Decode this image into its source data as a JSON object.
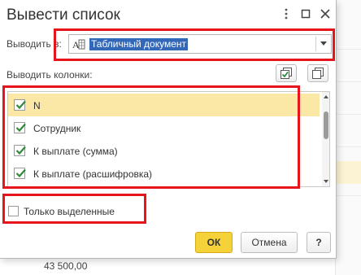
{
  "dialog": {
    "title": "Вывести список",
    "menu_icon": "more-vertical-icon",
    "maximize_icon": "maximize-icon",
    "close_icon": "close-icon"
  },
  "output": {
    "label": "Выводить в:",
    "selected_value": "Табличный документ",
    "icon": "spreadsheet-document-icon"
  },
  "columns": {
    "label": "Выводить колонки:",
    "check_all_icon": "check-all-icon",
    "copy_icon": "copy-icon",
    "items": [
      {
        "label": "N",
        "checked": true,
        "selected": true
      },
      {
        "label": "Сотрудник",
        "checked": true,
        "selected": false
      },
      {
        "label": "К выплате (сумма)",
        "checked": true,
        "selected": false
      },
      {
        "label": "К выплате (расшифровка)",
        "checked": true,
        "selected": false
      }
    ]
  },
  "only_selected": {
    "label": "Только выделенные",
    "checked": false
  },
  "buttons": {
    "ok": "ОК",
    "cancel": "Отмена",
    "help": "?"
  },
  "background": {
    "amount": "43 500,00"
  },
  "colors": {
    "accent_button": "#f5d23a",
    "selection_row": "#fbe8a6",
    "selected_text_bg": "#3367b8",
    "annotation_frame": "#e8141b",
    "checkmark": "#2e8b3a"
  }
}
